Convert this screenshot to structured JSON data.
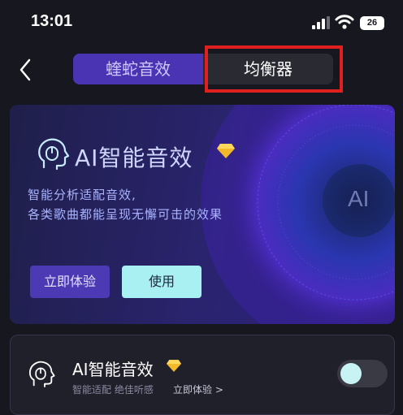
{
  "status_bar": {
    "time": "13:01",
    "battery": "26"
  },
  "tabs": [
    {
      "label": "蝰蛇音效"
    },
    {
      "label": "均衡器"
    }
  ],
  "hero": {
    "title": "AI智能音效",
    "desc_line1": "智能分析适配音效,",
    "desc_line2": "各类歌曲都能呈现无懈可击的效果",
    "badge": "AI",
    "try_label": "立即体验",
    "use_label": "使用"
  },
  "feature_row": {
    "title": "AI智能音效",
    "subtitle": "智能适配 绝佳听感",
    "link": "立即体验 >",
    "toggle_on": false
  },
  "colors": {
    "accent": "#4a34b3",
    "highlight": "#e0201f",
    "cyan": "#a8f0f2"
  }
}
